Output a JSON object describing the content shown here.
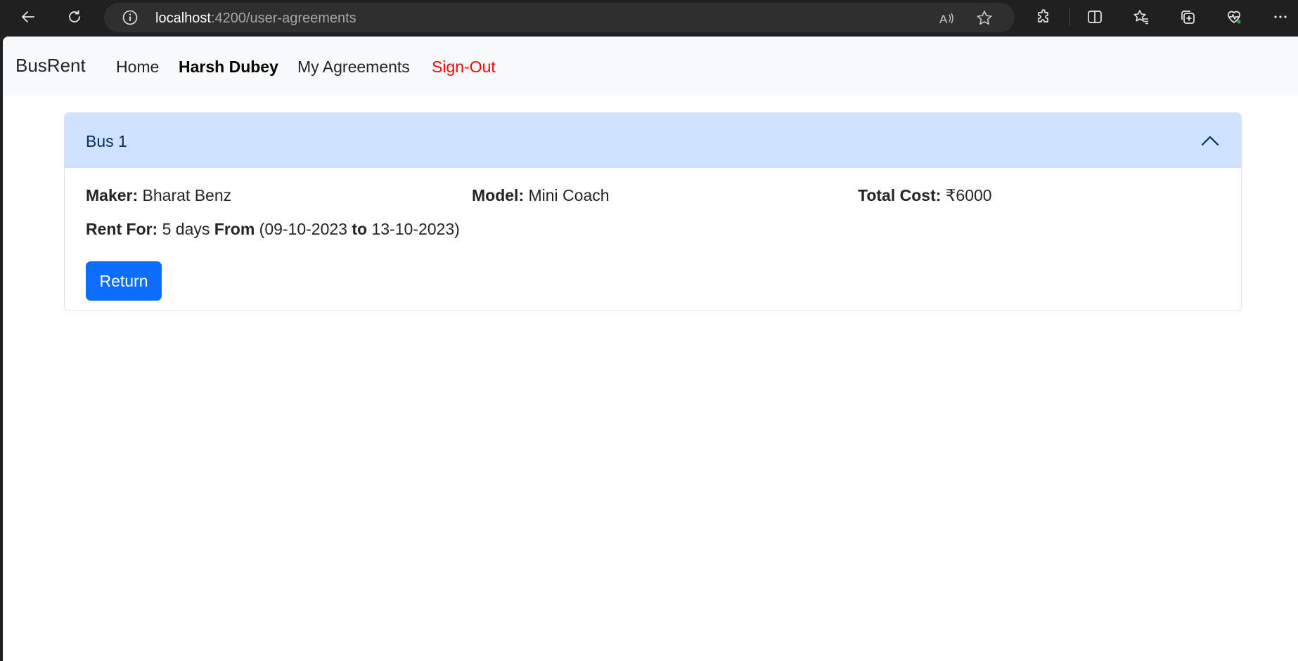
{
  "browser": {
    "url_host": "localhost",
    "url_path": ":4200/user-agreements",
    "icons": {
      "back": "back-arrow-icon",
      "refresh": "refresh-icon",
      "site_info": "info-icon",
      "read_aloud": "read-aloud-icon",
      "favorite": "star-icon",
      "extensions": "puzzle-icon",
      "split_screen": "split-screen-icon",
      "favorites": "favorites-icon",
      "collections": "collections-icon",
      "health": "heartbeat-icon",
      "more": "more-icon"
    }
  },
  "navbar": {
    "brand": "BusRent",
    "links": [
      {
        "label": "Home"
      },
      {
        "label": "Harsh Dubey"
      },
      {
        "label": "My Agreements"
      },
      {
        "label": "Sign-Out"
      }
    ]
  },
  "agreement": {
    "title": "Bus 1",
    "maker_label": "Maker:",
    "maker_value": "Bharat Benz",
    "model_label": "Model:",
    "model_value": "Mini Coach",
    "cost_label": "Total Cost:",
    "cost_value": "₹6000",
    "rent_label": "Rent For:",
    "rent_days": "5 days",
    "from_label": "From",
    "from_date": "(09-10-2023",
    "to_label": "to",
    "to_date": "13-10-2023)",
    "return_label": "Return"
  },
  "colors": {
    "accent": "#0d6efd",
    "header_bg": "#cfe2ff",
    "sign_out": "#ff0000"
  }
}
